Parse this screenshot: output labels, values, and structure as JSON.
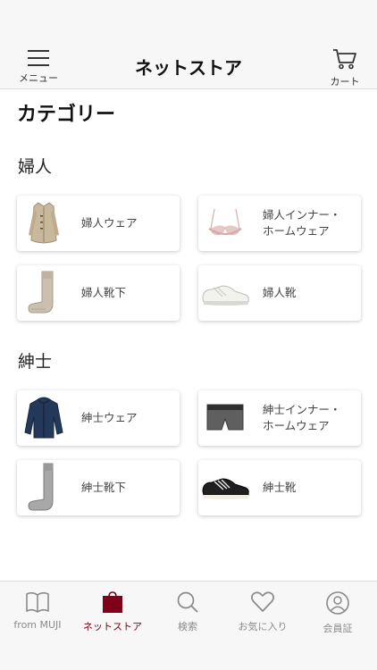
{
  "header": {
    "title": "ネットストア",
    "menu_label": "メニュー",
    "cart_label": "カート"
  },
  "page_title": "カテゴリー",
  "sections": [
    {
      "title": "婦人",
      "items": [
        {
          "label": "婦人ウェア",
          "icon": "womens-coat-icon"
        },
        {
          "label": "婦人インナー・\nホームウェア",
          "icon": "womens-bra-icon"
        },
        {
          "label": "婦人靴下",
          "icon": "womens-socks-icon"
        },
        {
          "label": "婦人靴",
          "icon": "womens-sneakers-icon"
        }
      ]
    },
    {
      "title": "紳士",
      "items": [
        {
          "label": "紳士ウェア",
          "icon": "mens-jacket-icon"
        },
        {
          "label": "紳士インナー・\nホームウェア",
          "icon": "mens-boxer-icon"
        },
        {
          "label": "紳士靴下",
          "icon": "mens-socks-icon"
        },
        {
          "label": "紳士靴",
          "icon": "mens-sneakers-icon"
        }
      ]
    }
  ],
  "tabbar": [
    {
      "label": "from MUJI",
      "icon": "book-icon"
    },
    {
      "label": "ネットストア",
      "icon": "shopping-bag-icon",
      "active": true
    },
    {
      "label": "検索",
      "icon": "search-icon"
    },
    {
      "label": "お気に入り",
      "icon": "heart-icon"
    },
    {
      "label": "会員証",
      "icon": "member-icon"
    }
  ],
  "colors": {
    "accent": "#7f0019",
    "inactive_tab": "#8a8a8a",
    "bar_background": "#f7f7f7"
  }
}
